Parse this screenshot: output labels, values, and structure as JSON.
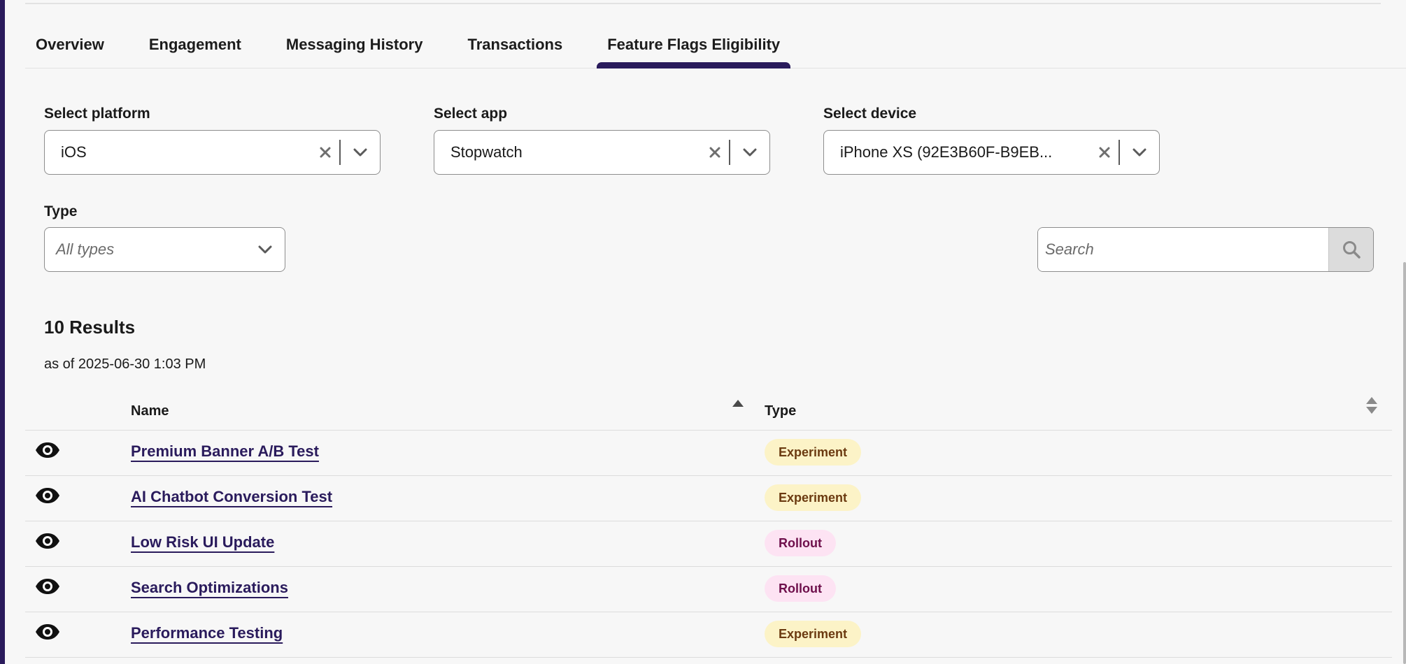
{
  "tabs": [
    {
      "label": "Overview",
      "active": false
    },
    {
      "label": "Engagement",
      "active": false
    },
    {
      "label": "Messaging History",
      "active": false
    },
    {
      "label": "Transactions",
      "active": false
    },
    {
      "label": "Feature Flags Eligibility",
      "active": true
    }
  ],
  "filters": {
    "platform": {
      "label": "Select platform",
      "value": "iOS"
    },
    "app": {
      "label": "Select app",
      "value": "Stopwatch"
    },
    "device": {
      "label": "Select device",
      "value": "iPhone XS (92E3B60F-B9EB..."
    },
    "type": {
      "label": "Type",
      "placeholder": "All types"
    }
  },
  "search": {
    "placeholder": "Search"
  },
  "results": {
    "title": "10 Results",
    "as_of": "as of 2025-06-30 1:03 PM"
  },
  "table": {
    "columns": {
      "name": "Name",
      "type": "Type"
    },
    "rows": [
      {
        "name": "Premium Banner A/B Test",
        "type": "Experiment"
      },
      {
        "name": "AI Chatbot Conversion Test",
        "type": "Experiment"
      },
      {
        "name": "Low Risk UI Update",
        "type": "Rollout"
      },
      {
        "name": "Search Optimizations",
        "type": "Rollout"
      },
      {
        "name": "Performance Testing",
        "type": "Experiment"
      }
    ]
  },
  "icons": {
    "clear": "close-icon",
    "dropdown": "chevron-down-icon",
    "search": "search-icon",
    "row": "eye-icon",
    "sort_name": "sort-ascending-icon",
    "sort_type": "sort-icon"
  },
  "colors": {
    "brand": "#2a1b5c",
    "experiment_bg": "#fcf3c7",
    "experiment_text": "#6b3a10",
    "rollout_bg": "#fde3f3",
    "rollout_text": "#6e0f4b"
  }
}
